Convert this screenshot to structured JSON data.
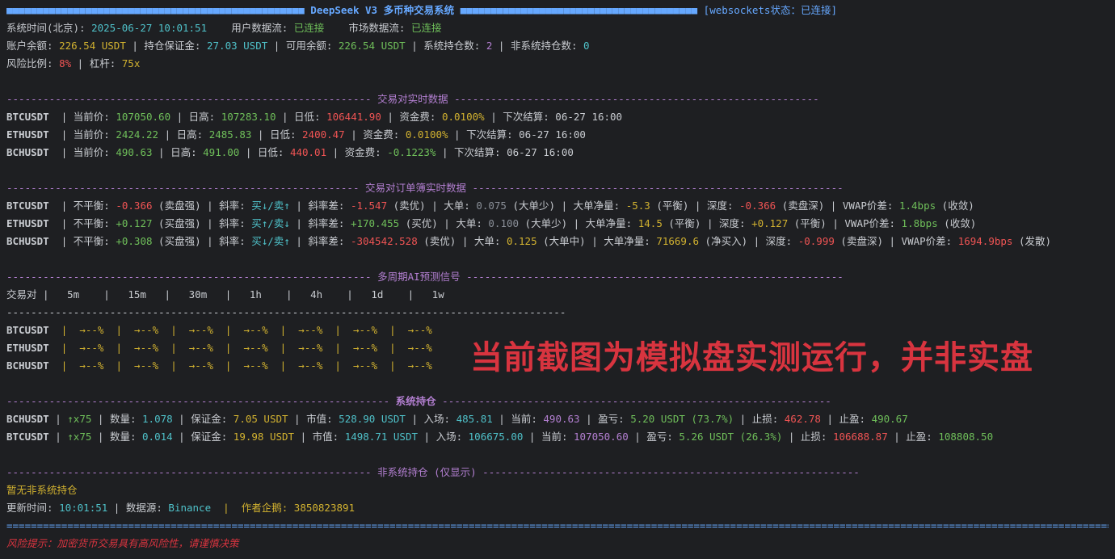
{
  "header": {
    "bar_left": "■■■■■■■■■■■■■■■■■■■■■■■■■■■■■■■■■■■■■■■■■■■■■■■■■",
    "title": "DeepSeek V3 多币种交易系统",
    "bar_right": "■■■■■■■■■■■■■■■■■■■■■■■■■■■■■■■■■■■■■■■",
    "ws_status": "[websockets状态：已连接]"
  },
  "status": {
    "time_label": "系统时间(北京): ",
    "time_value": "2025-06-27 10:01:51",
    "user_stream_label": "    用户数据流: ",
    "user_stream_value": "已连接",
    "market_stream_label": "    市场数据流: ",
    "market_stream_value": "已连接"
  },
  "account": {
    "balance_label": "账户余额: ",
    "balance_value": "226.54 USDT",
    "margin_label": " | 持仓保证金: ",
    "margin_value": "27.03 USDT",
    "available_label": " | 可用余额: ",
    "available_value": "226.54 USDT",
    "sys_pos_label": " | 系统持仓数: ",
    "sys_pos_value": "2",
    "nonsys_pos_label": " | 非系统持仓数: ",
    "nonsys_pos_value": "0",
    "risk_label": "风险比例: ",
    "risk_value": "8%",
    "leverage_label": " | 杠杆: ",
    "leverage_value": "75x"
  },
  "sections": {
    "realtime": {
      "left": "------------------------------------------------------------ ",
      "title": "交易对实时数据",
      "right": " ------------------------------------------------------------"
    },
    "orderbook": {
      "left": "---------------------------------------------------------- ",
      "title": "交易对订单簿实时数据",
      "right": " -------------------------------------------------------------"
    },
    "ai": {
      "left": "------------------------------------------------------------ ",
      "title": "多周期AI预测信号",
      "right": " --------------------------------------------------------------"
    },
    "positions": {
      "left": "--------------------------------------------------------------- ",
      "title": "系统持仓",
      "right": " ----------------------------------------------------------------"
    },
    "nonsys": {
      "left": "------------------------------------------------------------ ",
      "title": "非系统持仓 (仅显示)",
      "right": " --------------------------------------------------------------"
    }
  },
  "realtime_rows": [
    {
      "sym": "BTCUSDT ",
      "price_label": " | 当前价: ",
      "price": "107050.60",
      "high_label": " | 日高: ",
      "high": "107283.10",
      "low_label": " | 日低: ",
      "low": "106441.90",
      "fund_label": " | 资金费: ",
      "fund": "0.0100%",
      "settle": " | 下次结算: 06-27 16:00"
    },
    {
      "sym": "ETHUSDT ",
      "price_label": " | 当前价: ",
      "price": "2424.22",
      "high_label": " | 日高: ",
      "high": "2485.83",
      "low_label": " | 日低: ",
      "low": "2400.47",
      "fund_label": " | 资金费: ",
      "fund": "0.0100%",
      "settle": " | 下次结算: 06-27 16:00"
    },
    {
      "sym": "BCHUSDT ",
      "price_label": " | 当前价: ",
      "price": "490.63",
      "high_label": " | 日高: ",
      "high": "491.00",
      "low_label": " | 日低: ",
      "low": "440.01",
      "fund_label": " | 资金费: ",
      "fund": "-0.1223%",
      "settle": " | 下次结算: 06-27 16:00"
    }
  ],
  "orderbook_rows": [
    {
      "sym": "BTCUSDT ",
      "imb": "-0.366",
      "imb_note": " (卖盘强)",
      "slope": "买↓/卖↑",
      "slope_diff": "-1.547",
      "slope_note": " (卖优)",
      "big": "0.075",
      "big_note": " (大单少)",
      "big_net": "-5.3",
      "big_net_note": " (平衡)",
      "depth": "-0.366",
      "depth_note": " (卖盘深)",
      "vwap": "1.4bps",
      "vwap_note": " (收敛)"
    },
    {
      "sym": "ETHUSDT ",
      "imb": "+0.127",
      "imb_note": " (买盘强)",
      "slope": "买↑/卖↓",
      "slope_diff": "+170.455",
      "slope_note": " (买优)",
      "big": "0.100",
      "big_note": " (大单少)",
      "big_net": "14.5",
      "big_net_note": " (平衡)",
      "depth": "+0.127",
      "depth_note": " (平衡)",
      "vwap": "1.8bps",
      "vwap_note": " (收敛)"
    },
    {
      "sym": "BCHUSDT ",
      "imb": "+0.308",
      "imb_note": " (买盘强)",
      "slope": "买↓/卖↑",
      "slope_diff": "-304542.528",
      "slope_note": " (卖优)",
      "big": "0.125",
      "big_note": " (大单中)",
      "big_net": "71669.6",
      "big_net_note": " (净买入)",
      "depth": "-0.999",
      "depth_note": " (卖盘深)",
      "vwap": "1694.9bps",
      "vwap_note": " (发散)"
    }
  ],
  "orderbook_labels": {
    "imb": " | 不平衡: ",
    "slope": " | 斜率: ",
    "slope_diff": " | 斜率差: ",
    "big": " | 大单: ",
    "big_net": " | 大单净量: ",
    "depth": " | 深度: ",
    "vwap": " | VWAP价差: "
  },
  "ai": {
    "header": "交易对 |   5m    |   15m   |   30m   |   1h    |   4h    |   1d    |   1w",
    "divider": "--------------------------------------------------------------------------------------------",
    "rows": [
      {
        "sym": "BTCUSDT ",
        "cells": " |  →--%  |  →--%  |  →--%  |  →--%  |  →--%  |  →--%  |  →--%"
      },
      {
        "sym": "ETHUSDT ",
        "cells": " |  →--%  |  →--%  |  →--%  |  →--%  |  →--%  |  →--%  |  →--%"
      },
      {
        "sym": "BCHUSDT ",
        "cells": " |  →--%  |  →--%  |  →--%  |  →--%  |  →--%  |  →--%  |  →--%"
      }
    ]
  },
  "positions": [
    {
      "sym": "BCHUSDT",
      "dir": "↑x75",
      "qty": "1.078",
      "margin": "7.05 USDT",
      "value": "528.90 USDT",
      "entry": "485.81",
      "current": "490.63",
      "pnl": "5.20 USDT (73.7%)",
      "sl": "462.78",
      "tp": "490.67"
    },
    {
      "sym": "BTCUSDT",
      "dir": "↑x75",
      "qty": "0.014",
      "margin": "19.98 USDT",
      "value": "1498.71 USDT",
      "entry": "106675.00",
      "current": "107050.60",
      "pnl": "5.26 USDT (26.3%)",
      "sl": "106688.87",
      "tp": "108808.50"
    }
  ],
  "position_labels": {
    "qty": " | 数量: ",
    "margin": " | 保证金: ",
    "value": " | 市值: ",
    "entry": " | 入场: ",
    "current": " | 当前: ",
    "pnl": " | 盈亏: ",
    "sl": " | 止损: ",
    "tp": " | 止盈: "
  },
  "nonsys": {
    "empty": "暂无非系统持仓"
  },
  "footer": {
    "update_label": "更新时间: ",
    "update_value": "10:01:51",
    "source_label": " | 数据源: ",
    "source_value": "Binance",
    "author": "  |  作者企鹅: 3850823891",
    "rule": "=====================================================================================================================================================================================================",
    "risk_note": "风险提示：加密货币交易具有高风险性，请谨慎决策"
  },
  "overlay_text": "当前截图为模拟盘实测运行，并非实盘",
  "colors": {
    "background": "#1e1f22",
    "green": "#6fbf5a",
    "red": "#f05454",
    "yellow": "#d2b230",
    "cyan": "#4fc1c9",
    "magenta": "#b37fd1",
    "blue": "#66a8ff"
  }
}
